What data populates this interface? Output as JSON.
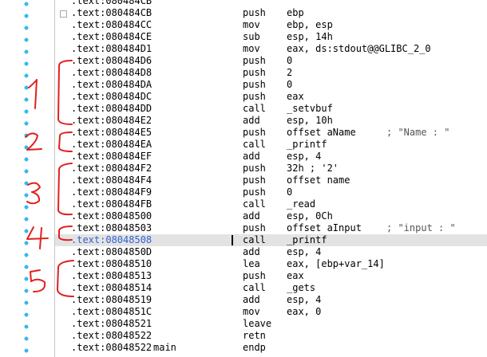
{
  "rows": [
    {
      "addr": ".text:080484CB",
      "name": "",
      "mnem": "",
      "ops": "",
      "cmt": ""
    },
    {
      "addr": ".text:080484CB",
      "name": "",
      "mnem": "push",
      "ops": "ebp",
      "cmt": ""
    },
    {
      "addr": ".text:080484CC",
      "name": "",
      "mnem": "mov",
      "ops": "ebp, esp",
      "cmt": ""
    },
    {
      "addr": ".text:080484CE",
      "name": "",
      "mnem": "sub",
      "ops": "esp, 14h",
      "cmt": ""
    },
    {
      "addr": ".text:080484D1",
      "name": "",
      "mnem": "mov",
      "ops": "eax, ds:stdout@@GLIBC_2_0",
      "cmt": ""
    },
    {
      "addr": ".text:080484D6",
      "name": "",
      "mnem": "push",
      "ops": "0",
      "cmt": ""
    },
    {
      "addr": ".text:080484D8",
      "name": "",
      "mnem": "push",
      "ops": "2",
      "cmt": ""
    },
    {
      "addr": ".text:080484DA",
      "name": "",
      "mnem": "push",
      "ops": "0",
      "cmt": ""
    },
    {
      "addr": ".text:080484DC",
      "name": "",
      "mnem": "push",
      "ops": "eax",
      "cmt": ""
    },
    {
      "addr": ".text:080484DD",
      "name": "",
      "mnem": "call",
      "ops": "_setvbuf",
      "cmt": ""
    },
    {
      "addr": ".text:080484E2",
      "name": "",
      "mnem": "add",
      "ops": "esp, 10h",
      "cmt": ""
    },
    {
      "addr": ".text:080484E5",
      "name": "",
      "mnem": "push",
      "ops": "offset aName",
      "cmt": "; \"Name : \""
    },
    {
      "addr": ".text:080484EA",
      "name": "",
      "mnem": "call",
      "ops": "_printf",
      "cmt": ""
    },
    {
      "addr": ".text:080484EF",
      "name": "",
      "mnem": "add",
      "ops": "esp, 4",
      "cmt": ""
    },
    {
      "addr": ".text:080484F2",
      "name": "",
      "mnem": "push",
      "ops": "32h ; '2'",
      "cmt": ""
    },
    {
      "addr": ".text:080484F4",
      "name": "",
      "mnem": "push",
      "ops": "offset name",
      "cmt": ""
    },
    {
      "addr": ".text:080484F9",
      "name": "",
      "mnem": "push",
      "ops": "0",
      "cmt": ""
    },
    {
      "addr": ".text:080484FB",
      "name": "",
      "mnem": "call",
      "ops": "_read",
      "cmt": ""
    },
    {
      "addr": ".text:08048500",
      "name": "",
      "mnem": "add",
      "ops": "esp, 0Ch",
      "cmt": ""
    },
    {
      "addr": ".text:08048503",
      "name": "",
      "mnem": "push",
      "ops": "offset aInput",
      "cmt": "; \"input : \""
    },
    {
      "addr": ".text:08048508",
      "name": "",
      "mnem": "call",
      "ops": "_printf",
      "cmt": "",
      "highlight": true
    },
    {
      "addr": ".text:0804850D",
      "name": "",
      "mnem": "add",
      "ops": "esp, 4",
      "cmt": ""
    },
    {
      "addr": ".text:08048510",
      "name": "",
      "mnem": "lea",
      "ops": "eax, [ebp+var_14]",
      "cmt": ""
    },
    {
      "addr": ".text:08048513",
      "name": "",
      "mnem": "push",
      "ops": "eax",
      "cmt": ""
    },
    {
      "addr": ".text:08048514",
      "name": "",
      "mnem": "call",
      "ops": "_gets",
      "cmt": ""
    },
    {
      "addr": ".text:08048519",
      "name": "",
      "mnem": "add",
      "ops": "esp, 4",
      "cmt": ""
    },
    {
      "addr": ".text:0804851C",
      "name": "",
      "mnem": "mov",
      "ops": "eax, 0",
      "cmt": ""
    },
    {
      "addr": ".text:08048521",
      "name": "",
      "mnem": "leave",
      "ops": "",
      "cmt": ""
    },
    {
      "addr": ".text:08048522",
      "name": "",
      "mnem": "retn",
      "ops": "",
      "cmt": ""
    },
    {
      "addr": ".text:08048522",
      "name": "main",
      "mnem": "endp",
      "ops": "",
      "cmt": ""
    }
  ],
  "annotations": [
    {
      "label": "1",
      "color": "#e0201e"
    },
    {
      "label": "2",
      "color": "#e0201e"
    },
    {
      "label": "3",
      "color": "#e0201e"
    },
    {
      "label": "4",
      "color": "#e0201e"
    },
    {
      "label": "5",
      "color": "#e0201e"
    }
  ],
  "colors": {
    "dots": "#35b8ee",
    "highlight_row": "#e3e3e3",
    "highlight_addr": "#2f62cf",
    "annotation": "#e0201e"
  }
}
